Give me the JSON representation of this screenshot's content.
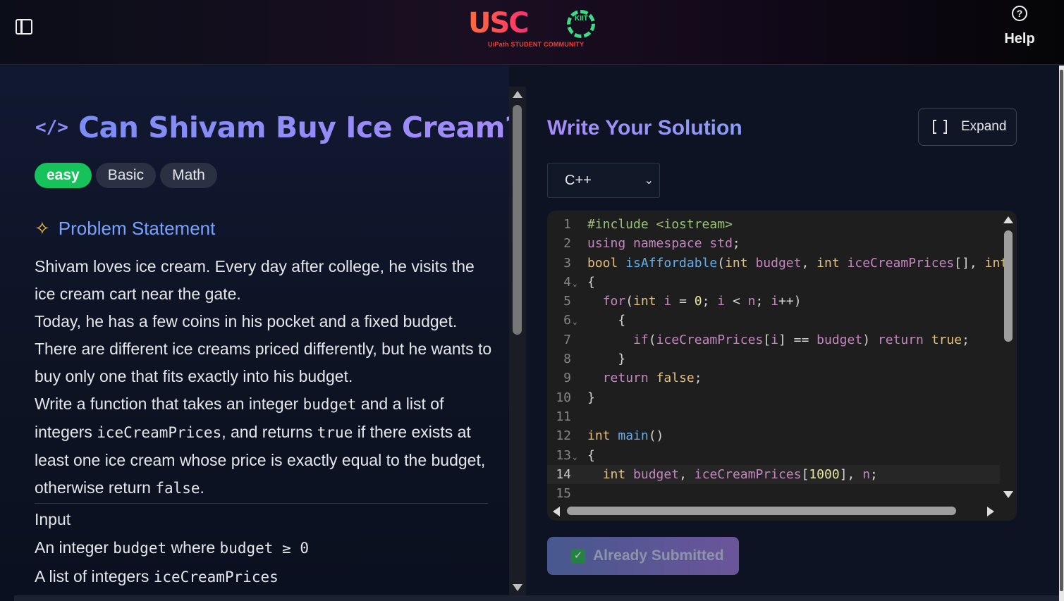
{
  "header": {
    "logo_text": "USC",
    "logo_badge": "KIIT",
    "logo_subtitle": "UiPath STUDENT COMMUNITY",
    "help_label": "Help"
  },
  "problem": {
    "title": "Can Shivam Buy Ice Cream?",
    "tags": [
      "easy",
      "Basic",
      "Math"
    ],
    "section_title": "Problem Statement",
    "statement": {
      "p1": "Shivam loves ice cream. Every day after college, he visits the ice cream cart near the gate.",
      "p2": "Today, he has a few coins in his pocket and a fixed budget.",
      "p3": "There are different ice creams priced differently, but he wants to buy only one that fits exactly into his budget.",
      "p4_a": "Write a function that takes an integer ",
      "p4_code1": "budget",
      "p4_b": " and a list of integers ",
      "p4_code2": "iceCreamPrices",
      "p4_c": ", and returns ",
      "p4_code3": "true",
      "p4_d": " if there exists at least one ice cream whose price is exactly equal to the budget, otherwise return ",
      "p4_code4": "false",
      "p4_e": "."
    },
    "input_heading": "Input",
    "input_line1_a": "An integer ",
    "input_line1_code1": "budget",
    "input_line1_b": " where ",
    "input_line1_code2": "budget ≥ 0",
    "input_line2_a": "A list of integers ",
    "input_line2_code": "iceCreamPrices"
  },
  "solution": {
    "title": "Write Your Solution",
    "expand_label": "Expand",
    "language": "C++",
    "submit_label": "Already Submitted"
  },
  "code_lines": [
    "#include <iostream>",
    "using namespace std;",
    "bool isAffordable(int budget, int iceCreamPrices[], int",
    "{",
    "  for(int i = 0; i < n; i++)",
    "    {",
    "      if(iceCreamPrices[i] == budget) return true;",
    "    }",
    "  return false;",
    "}",
    "",
    "int main()",
    "{",
    "  int budget, iceCreamPrices[1000], n;",
    ""
  ],
  "colors": {
    "accent": "#8b7cf6",
    "easy_tag": "#16c35a",
    "section_title": "#7aa2ff"
  }
}
